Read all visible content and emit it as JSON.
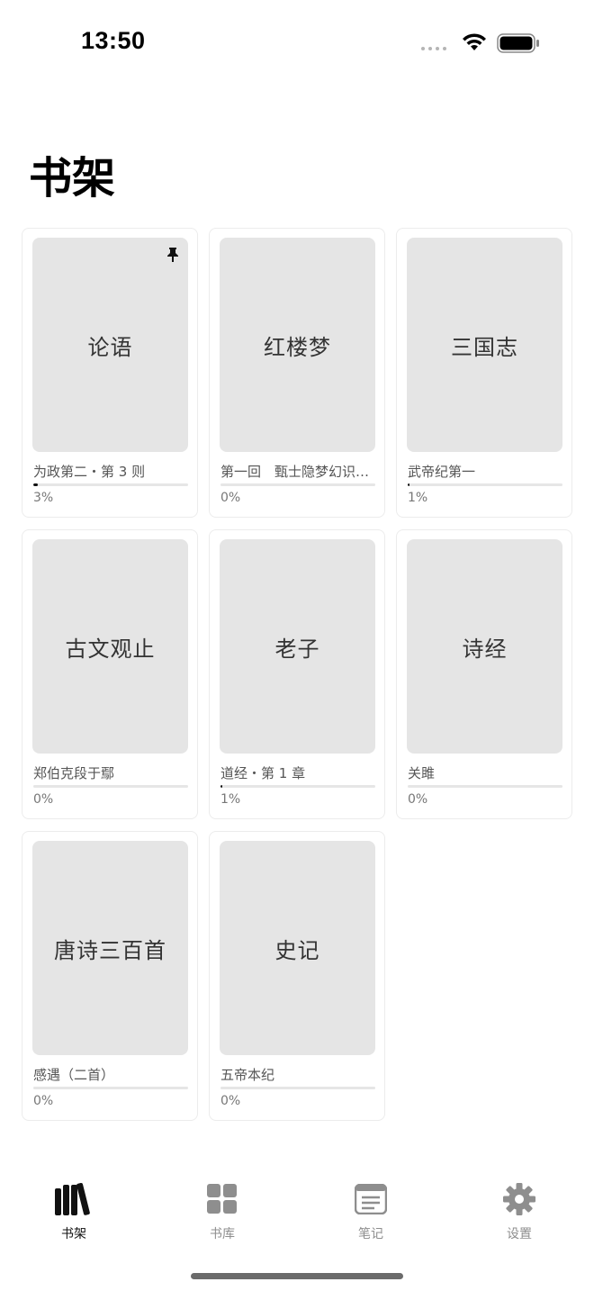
{
  "status": {
    "time": "13:50"
  },
  "title": "书架",
  "books": [
    {
      "title": "论语",
      "chapter": "为政第二・第 3 则",
      "progress": 0.03,
      "percent": "3%",
      "pinned": true
    },
    {
      "title": "红楼梦",
      "chapter": "第一回　甄士隐梦幻识通灵",
      "progress": 0.0,
      "percent": "0%",
      "pinned": false
    },
    {
      "title": "三国志",
      "chapter": "武帝纪第一",
      "progress": 0.01,
      "percent": "1%",
      "pinned": false
    },
    {
      "title": "古文观止",
      "chapter": "郑伯克段于鄢",
      "progress": 0.0,
      "percent": "0%",
      "pinned": false
    },
    {
      "title": "老子",
      "chapter": "道经・第 1 章",
      "progress": 0.01,
      "percent": "1%",
      "pinned": false
    },
    {
      "title": "诗经",
      "chapter": "关雎",
      "progress": 0.0,
      "percent": "0%",
      "pinned": false
    },
    {
      "title": "唐诗三百首",
      "chapter": "感遇（二首）",
      "progress": 0.0,
      "percent": "0%",
      "pinned": false
    },
    {
      "title": "史记",
      "chapter": "五帝本纪",
      "progress": 0.0,
      "percent": "0%",
      "pinned": false
    }
  ],
  "tabs": [
    {
      "label": "书架",
      "icon": "bookshelf-icon",
      "active": true
    },
    {
      "label": "书库",
      "icon": "grid-icon",
      "active": false
    },
    {
      "label": "笔记",
      "icon": "notes-icon",
      "active": false
    },
    {
      "label": "设置",
      "icon": "gear-icon",
      "active": false
    }
  ],
  "colors": {
    "cover": "#e5e5e5",
    "active": "#111111",
    "inactive": "#8e8e8e"
  }
}
